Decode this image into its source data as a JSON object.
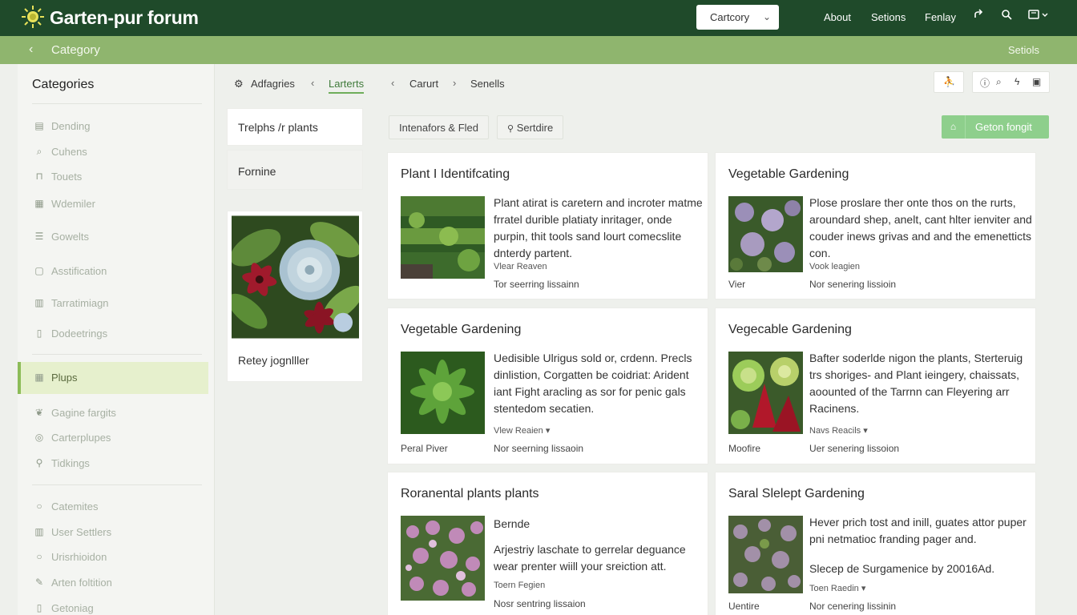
{
  "topbar": {
    "brand": "Garten-pur forum",
    "category_select": "Cartcory",
    "links": [
      "About",
      "Setions",
      "Fenlay"
    ],
    "icons": [
      "share-icon",
      "search-icon",
      "folder-icon"
    ],
    "colors": {
      "topbar": "#1f4a2a",
      "subbar": "#8fb56e",
      "accent": "#8cbc58"
    }
  },
  "subbar": {
    "crumb": "Category",
    "right": "Setiols"
  },
  "sidebar": {
    "title": "Categories",
    "items": [
      {
        "label": "Dending",
        "icon": "image-icon"
      },
      {
        "label": "Cuhens",
        "icon": "search-icon"
      },
      {
        "label": "Touets",
        "icon": "lock-icon"
      },
      {
        "label": "Wdemiler",
        "icon": "calendar-icon"
      },
      {
        "label": "Gowelts",
        "icon": "list-icon"
      },
      {
        "label": "Asstification",
        "icon": "book-icon"
      },
      {
        "label": "Tarratimiagn",
        "icon": "document-icon"
      },
      {
        "label": "Dodeetrings",
        "icon": "file-icon"
      },
      {
        "label": "Plups",
        "icon": "plant-icon"
      },
      {
        "label": "Gagine fargits",
        "icon": "leaf-icon"
      },
      {
        "label": "Carterplupes",
        "icon": "target-icon"
      },
      {
        "label": "Tidkings",
        "icon": "wrench-icon"
      },
      {
        "label": "Catemites",
        "icon": "circle-icon"
      },
      {
        "label": "User Settlers",
        "icon": "user-icon"
      },
      {
        "label": "Urisrhioidon",
        "icon": "circle-icon"
      },
      {
        "label": "Arten foltition",
        "icon": "edit-icon"
      },
      {
        "label": "Getoniag",
        "icon": "document-icon"
      }
    ]
  },
  "tabs": {
    "items": [
      "Adfagries",
      "Larterts",
      "Carurt",
      "Senells"
    ]
  },
  "toolbar_icons": [
    "people-icon",
    "info-icon",
    "search-icon",
    "bolt-icon",
    "image-icon"
  ],
  "subpanel": {
    "a": "Trelphs /r plants",
    "b": "Fornine",
    "c": "Retey jognlller"
  },
  "filters": {
    "pill1": "Intenafors & Fled",
    "pill2": "Sertdire",
    "button": "Geton fongit"
  },
  "cards": [
    {
      "title": "Plant I Identifcating",
      "body": "Plant atirat is caretern and incroter matme frratel durible platiaty inritager, onde purpin, thit tools sand lourt comecslite dnterdy partent.",
      "meta": "Vlear Reaven",
      "meta2": "Tor seerring lissainn",
      "author": ""
    },
    {
      "title": "Vegetable Gardening",
      "body": "Plose proslare ther onte thos on the rurts, aroundard shep, anelt, cant hlter ienviter and couder inews grivas and and the emenetticts con.",
      "meta": "Vook leagien",
      "meta2": "Nor senering lissioin",
      "author": "Vier"
    },
    {
      "title": "Vegetable Gardening",
      "body": "Uedisible Ulrigus sold or, crdenn. Precls dinlistion, Corgatten be coidriat: Arident iant Fight aracling as sor for penic gals stentedom secatien.",
      "meta": "Vlew Reaien ▾",
      "meta2": "Nor seerning lissaoin",
      "author": "Peral Piver"
    },
    {
      "title": "Vegecable Gardening",
      "body": "Bafter soderlde nigon the plants, Sterteruig trs shoriges- and Plant ieingery, chaissats, aoounted of the Tarrnn can Fleyering arr Racinens.",
      "meta": "Navs Reacils ▾",
      "meta2": "Uer senering lissoion",
      "author": "Moofire"
    },
    {
      "title": "Roranental plants plants",
      "body_top": "Bernde",
      "body": "Arjestriy laschate to gerrelar deguance wear prenter wiill your sreiction att.",
      "meta": "Toern Fegien",
      "meta2": "Nosr sentring lissaion",
      "author": ""
    },
    {
      "title": "Saral Slelept Gardening",
      "body": "Hever prich tost and inill, guates attor puper pni netmatioc franding pager and.",
      "body2": "Slecep de Surgamenice by 20016Ad.",
      "meta": "Toen Raedin ▾",
      "meta2": "Nor cenering lissinin",
      "author": "Uentire"
    }
  ]
}
